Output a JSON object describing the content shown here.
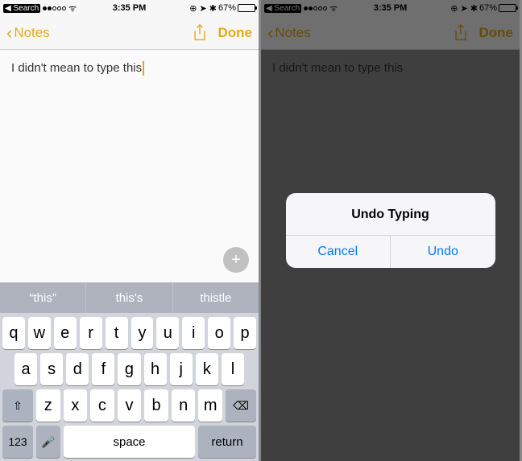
{
  "status": {
    "back_app": "Search",
    "time": "3:35 PM",
    "battery_pct": "67%",
    "carrier_icons": "⚲ ↑ ⚡"
  },
  "nav": {
    "back_label": "Notes",
    "done_label": "Done"
  },
  "note": {
    "text": "I didn't mean to type this"
  },
  "plus": "+",
  "keyboard": {
    "suggestions": [
      "“this”",
      "this's",
      "thistle"
    ],
    "row1": [
      "q",
      "w",
      "e",
      "r",
      "t",
      "y",
      "u",
      "i",
      "o",
      "p"
    ],
    "row2": [
      "a",
      "s",
      "d",
      "f",
      "g",
      "h",
      "j",
      "k",
      "l"
    ],
    "row3": [
      "z",
      "x",
      "c",
      "v",
      "b",
      "n",
      "m"
    ],
    "shift": "⇧",
    "backspace": "⌫",
    "numkey": "123",
    "mic": "🎤",
    "space": "space",
    "return": "return"
  },
  "alert": {
    "title": "Undo Typing",
    "cancel": "Cancel",
    "undo": "Undo"
  }
}
